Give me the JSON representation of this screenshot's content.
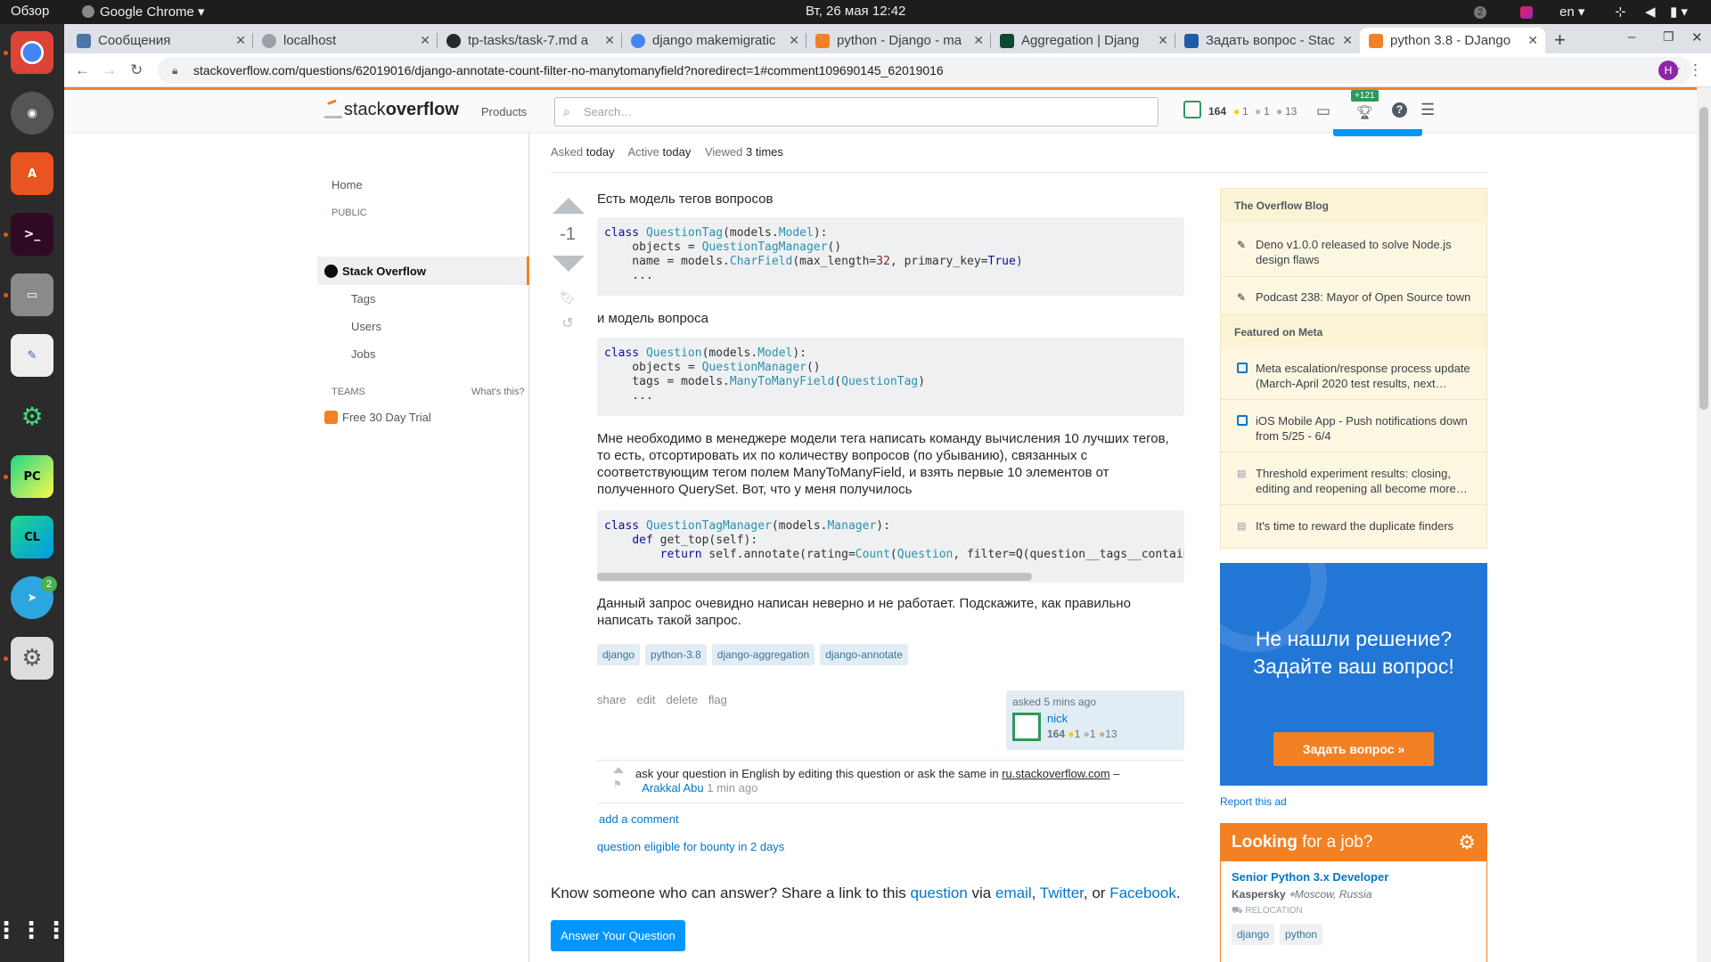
{
  "os": {
    "overview": "Обзор",
    "app_menu": "Google Chrome",
    "datetime": "Вт, 26 мая  12:42",
    "lang": "en",
    "notif_count": "2",
    "telegram_badge": "2"
  },
  "tabs": [
    {
      "title": "Сообщения",
      "color": "#4a76a8",
      "active": false
    },
    {
      "title": "localhost",
      "color": "#9aa0a6",
      "active": false
    },
    {
      "title": "tp-tasks/task-7.md a",
      "color": "#24292e",
      "active": false
    },
    {
      "title": "django makemigratic",
      "color": "#4285f4",
      "active": false
    },
    {
      "title": "python - Django - ma",
      "color": "#f48024",
      "active": false
    },
    {
      "title": "Aggregation | Djang",
      "color": "#0c4b33",
      "active": false
    },
    {
      "title": "Задать вопрос - Stac",
      "color": "#1e5ca8",
      "active": false
    },
    {
      "title": "python 3.8 - DJango",
      "color": "#f48024",
      "active": true
    }
  ],
  "url": "stackoverflow.com/questions/62019016/django-annotate-count-filter-no-manytomanyfield?noredirect=1#comment109690145_62019016",
  "profile_initial": "H",
  "so": {
    "logo_a": "stack",
    "logo_b": "overflow",
    "products": "Products",
    "search_placeholder": "Search…",
    "rep": "164",
    "gold": "1",
    "silver": "1",
    "bronze": "13",
    "achieve": "+121"
  },
  "nav": {
    "home": "Home",
    "public": "PUBLIC",
    "stackoverflow": "Stack Overflow",
    "tags": "Tags",
    "users": "Users",
    "jobs": "Jobs",
    "teams": "TEAMS",
    "whats_this": "What's this?",
    "trial": "Free 30 Day Trial"
  },
  "question": {
    "asked_label": "Asked",
    "asked": "today",
    "active_label": "Active",
    "active": "today",
    "viewed_label": "Viewed",
    "viewed": "3 times",
    "votes": "-1",
    "p1": "Есть модель тегов вопросов",
    "p2": "и модель вопроса",
    "p3": "Мне необходимо в менеджере модели тега написать команду вычисления 10 лучших тегов, то есть, отсортировать их по количеству вопросов (по убыванию), связанных с соответствующим тегом полем ManyToManyField, и взять первые 10 элементов от полученного QuerySet. Вот, что у меня получилось",
    "p4": "Данный запрос очевидно написан неверно и не работает. Подскажите, как правильно написать такой запрос.",
    "tags": [
      "django",
      "python-3.8",
      "django-aggregation",
      "django-annotate"
    ],
    "actions": [
      "share",
      "edit",
      "delete",
      "flag"
    ],
    "asked_when": "asked 5 mins ago",
    "user": "nick",
    "user_rep": "164",
    "user_gold": "1",
    "user_silver": "1",
    "user_bronze": "13",
    "comment_text": "ask your question in English by editing this question or ask the same in",
    "comment_link": "ru.stackoverflow.com",
    "comment_dash": "–",
    "comment_user": "Arakkal Abu",
    "comment_time": "1 min ago",
    "add_comment": "add a comment",
    "bounty": "question eligible for bounty in 2 days",
    "share_a": "Know someone who can answer? Share a link to this",
    "share_q": "question",
    "share_via": "via",
    "share_email": "email",
    "share_twitter": "Twitter",
    "share_or": ", or",
    "share_fb": "Facebook",
    "answer_btn": "Answer Your Question"
  },
  "blog": {
    "title": "The Overflow Blog",
    "items": [
      "Deno v1.0.0 released to solve Node.js design flaws",
      "Podcast 238: Mayor of Open Source town"
    ],
    "meta_title": "Featured on Meta",
    "meta_items": [
      "Meta escalation/response process update (March-April 2020 test results, next…",
      "iOS Mobile App - Push notifications down from 5/25 - 6/4",
      "Threshold experiment results: closing, editing and reopening all become more…",
      "It's time to reward the duplicate finders"
    ]
  },
  "ad": {
    "line1": "Не нашли решение?",
    "line2": "Задайте ваш вопрос!",
    "btn": "Задать вопрос »",
    "report": "Report this ad"
  },
  "jobs": {
    "head_a": "Looking",
    "head_b": " for a job?",
    "title": "Senior Python 3.x Developer",
    "company": "Kaspersky",
    "location": "Moscow, Russia",
    "relocation": "RELOCATION",
    "tags": [
      "django",
      "python"
    ]
  }
}
